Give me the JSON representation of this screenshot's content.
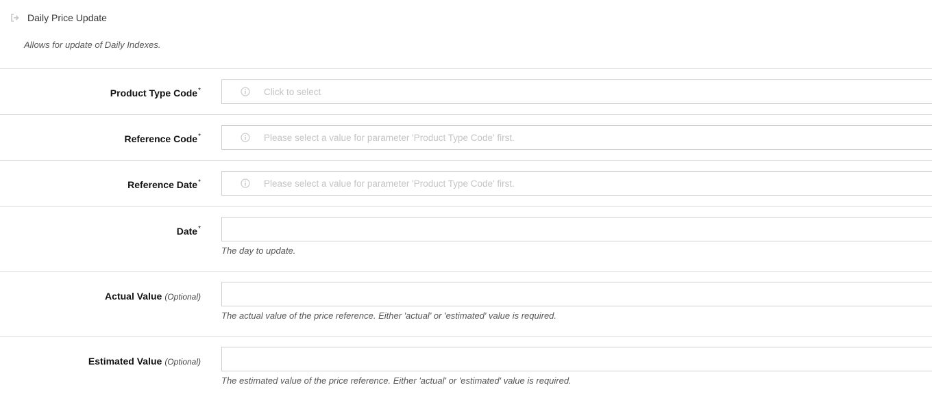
{
  "header": {
    "title": "Daily Price Update",
    "description": "Allows for update of Daily Indexes.",
    "title_icon": "sign-out-icon"
  },
  "fields": [
    {
      "label": "Product Type Code",
      "required_mark": "*",
      "optional_text": "",
      "placeholder": "Click to select",
      "help": "",
      "icon": "info-icon"
    },
    {
      "label": "Reference Code",
      "required_mark": "*",
      "optional_text": "",
      "placeholder": "Please select a value for parameter 'Product Type Code' first.",
      "help": "",
      "icon": "info-icon"
    },
    {
      "label": "Reference Date",
      "required_mark": "*",
      "optional_text": "",
      "placeholder": "Please select a value for parameter 'Product Type Code' first.",
      "help": "",
      "icon": "info-icon"
    },
    {
      "label": "Date",
      "required_mark": "*",
      "optional_text": "",
      "placeholder": "",
      "help": "The day to update.",
      "icon": ""
    },
    {
      "label": "Actual Value",
      "required_mark": "",
      "optional_text": "(Optional)",
      "placeholder": "",
      "help": "The actual value of the price reference. Either 'actual' or 'estimated' value is required.",
      "icon": ""
    },
    {
      "label": "Estimated Value",
      "required_mark": "",
      "optional_text": "(Optional)",
      "placeholder": "",
      "help": "The estimated value of the price reference. Either 'actual' or 'estimated' value is required.",
      "icon": ""
    }
  ],
  "colors": {
    "border": "#dcdcdc",
    "input_border": "#cfcfcf",
    "placeholder": "#c4c4c4"
  }
}
